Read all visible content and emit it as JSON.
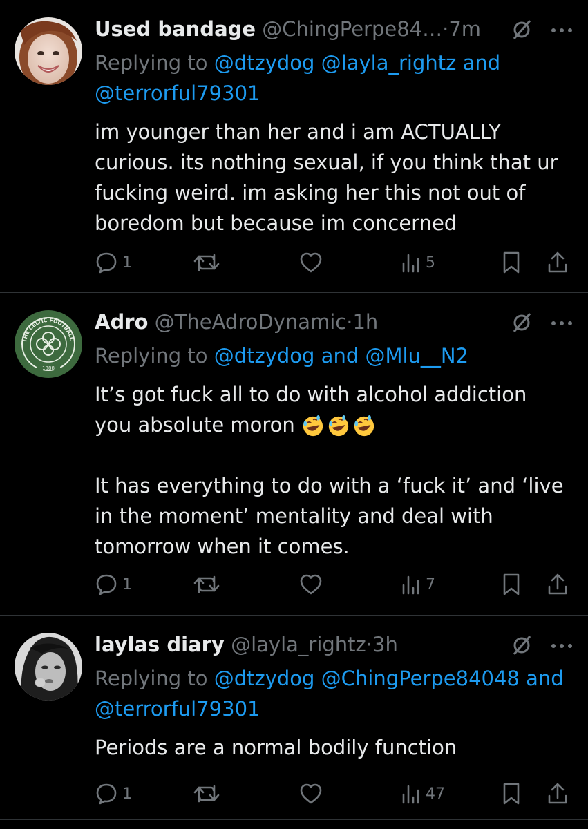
{
  "tweets": [
    {
      "name": "Used bandage",
      "handle": "@ChingPerpe84…",
      "separator": "·",
      "time": "7m",
      "replying_prefix": "Replying to",
      "mentions": [
        "@dtzydog",
        "@layla_rightz",
        "@terrorful79301"
      ],
      "replying_joiner": "and",
      "body": [
        "im younger than her and i am ACTUALLY",
        "curious. its nothing sexual, if you think that ur",
        "fucking weird. im asking her this not out of",
        "boredom but because im concerned"
      ],
      "replies": "1",
      "retweets": "",
      "likes": "",
      "views": "5",
      "avatar": "woman-smiling-photo"
    },
    {
      "name": "Adro",
      "handle": "@TheAdroDynamic",
      "separator": "·",
      "time": "1h",
      "replying_prefix": "Replying to",
      "mentions": [
        "@dtzydog",
        "@Mlu__N2"
      ],
      "replying_joiner": "and",
      "body": [
        "It’s got fuck all to do with alcohol addiction",
        "you absolute moron",
        "",
        "It has everything to do with a ‘fuck it’ and ‘live",
        "in the moment’ mentality and deal with",
        "tomorrow when it comes."
      ],
      "replies": "1",
      "retweets": "",
      "likes": "",
      "views": "7",
      "avatar": "celtic-football-club-crest",
      "crest_text": "THE CELTIC FOOTBALL CLUB",
      "crest_year": "1888"
    },
    {
      "name": "laylas diary",
      "handle": "@layla_rightz",
      "separator": "·",
      "time": "3h",
      "replying_prefix": "Replying to",
      "mentions": [
        "@dtzydog",
        "@ChingPerpe84048",
        "@terrorful79301"
      ],
      "replying_joiner": "and",
      "body": [
        "Periods are a normal bodily function"
      ],
      "replies": "1",
      "retweets": "",
      "likes": "",
      "views": "47",
      "avatar": "black-and-white-woman-photo"
    }
  ],
  "icons": {
    "reply": "speech-bubble-icon",
    "retweet": "retweet-icon",
    "like": "heart-icon",
    "views": "bar-chart-icon",
    "bookmark": "bookmark-icon",
    "share": "share-icon",
    "grok": "grok-slash-icon",
    "more": "ellipsis-icon",
    "emoji": "rolling-on-floor-laughing-emoji"
  },
  "colors": {
    "background": "#000000",
    "text": "#e7e9ea",
    "secondary": "#71767b",
    "link": "#1d9bf0",
    "divider": "#2f3336"
  }
}
